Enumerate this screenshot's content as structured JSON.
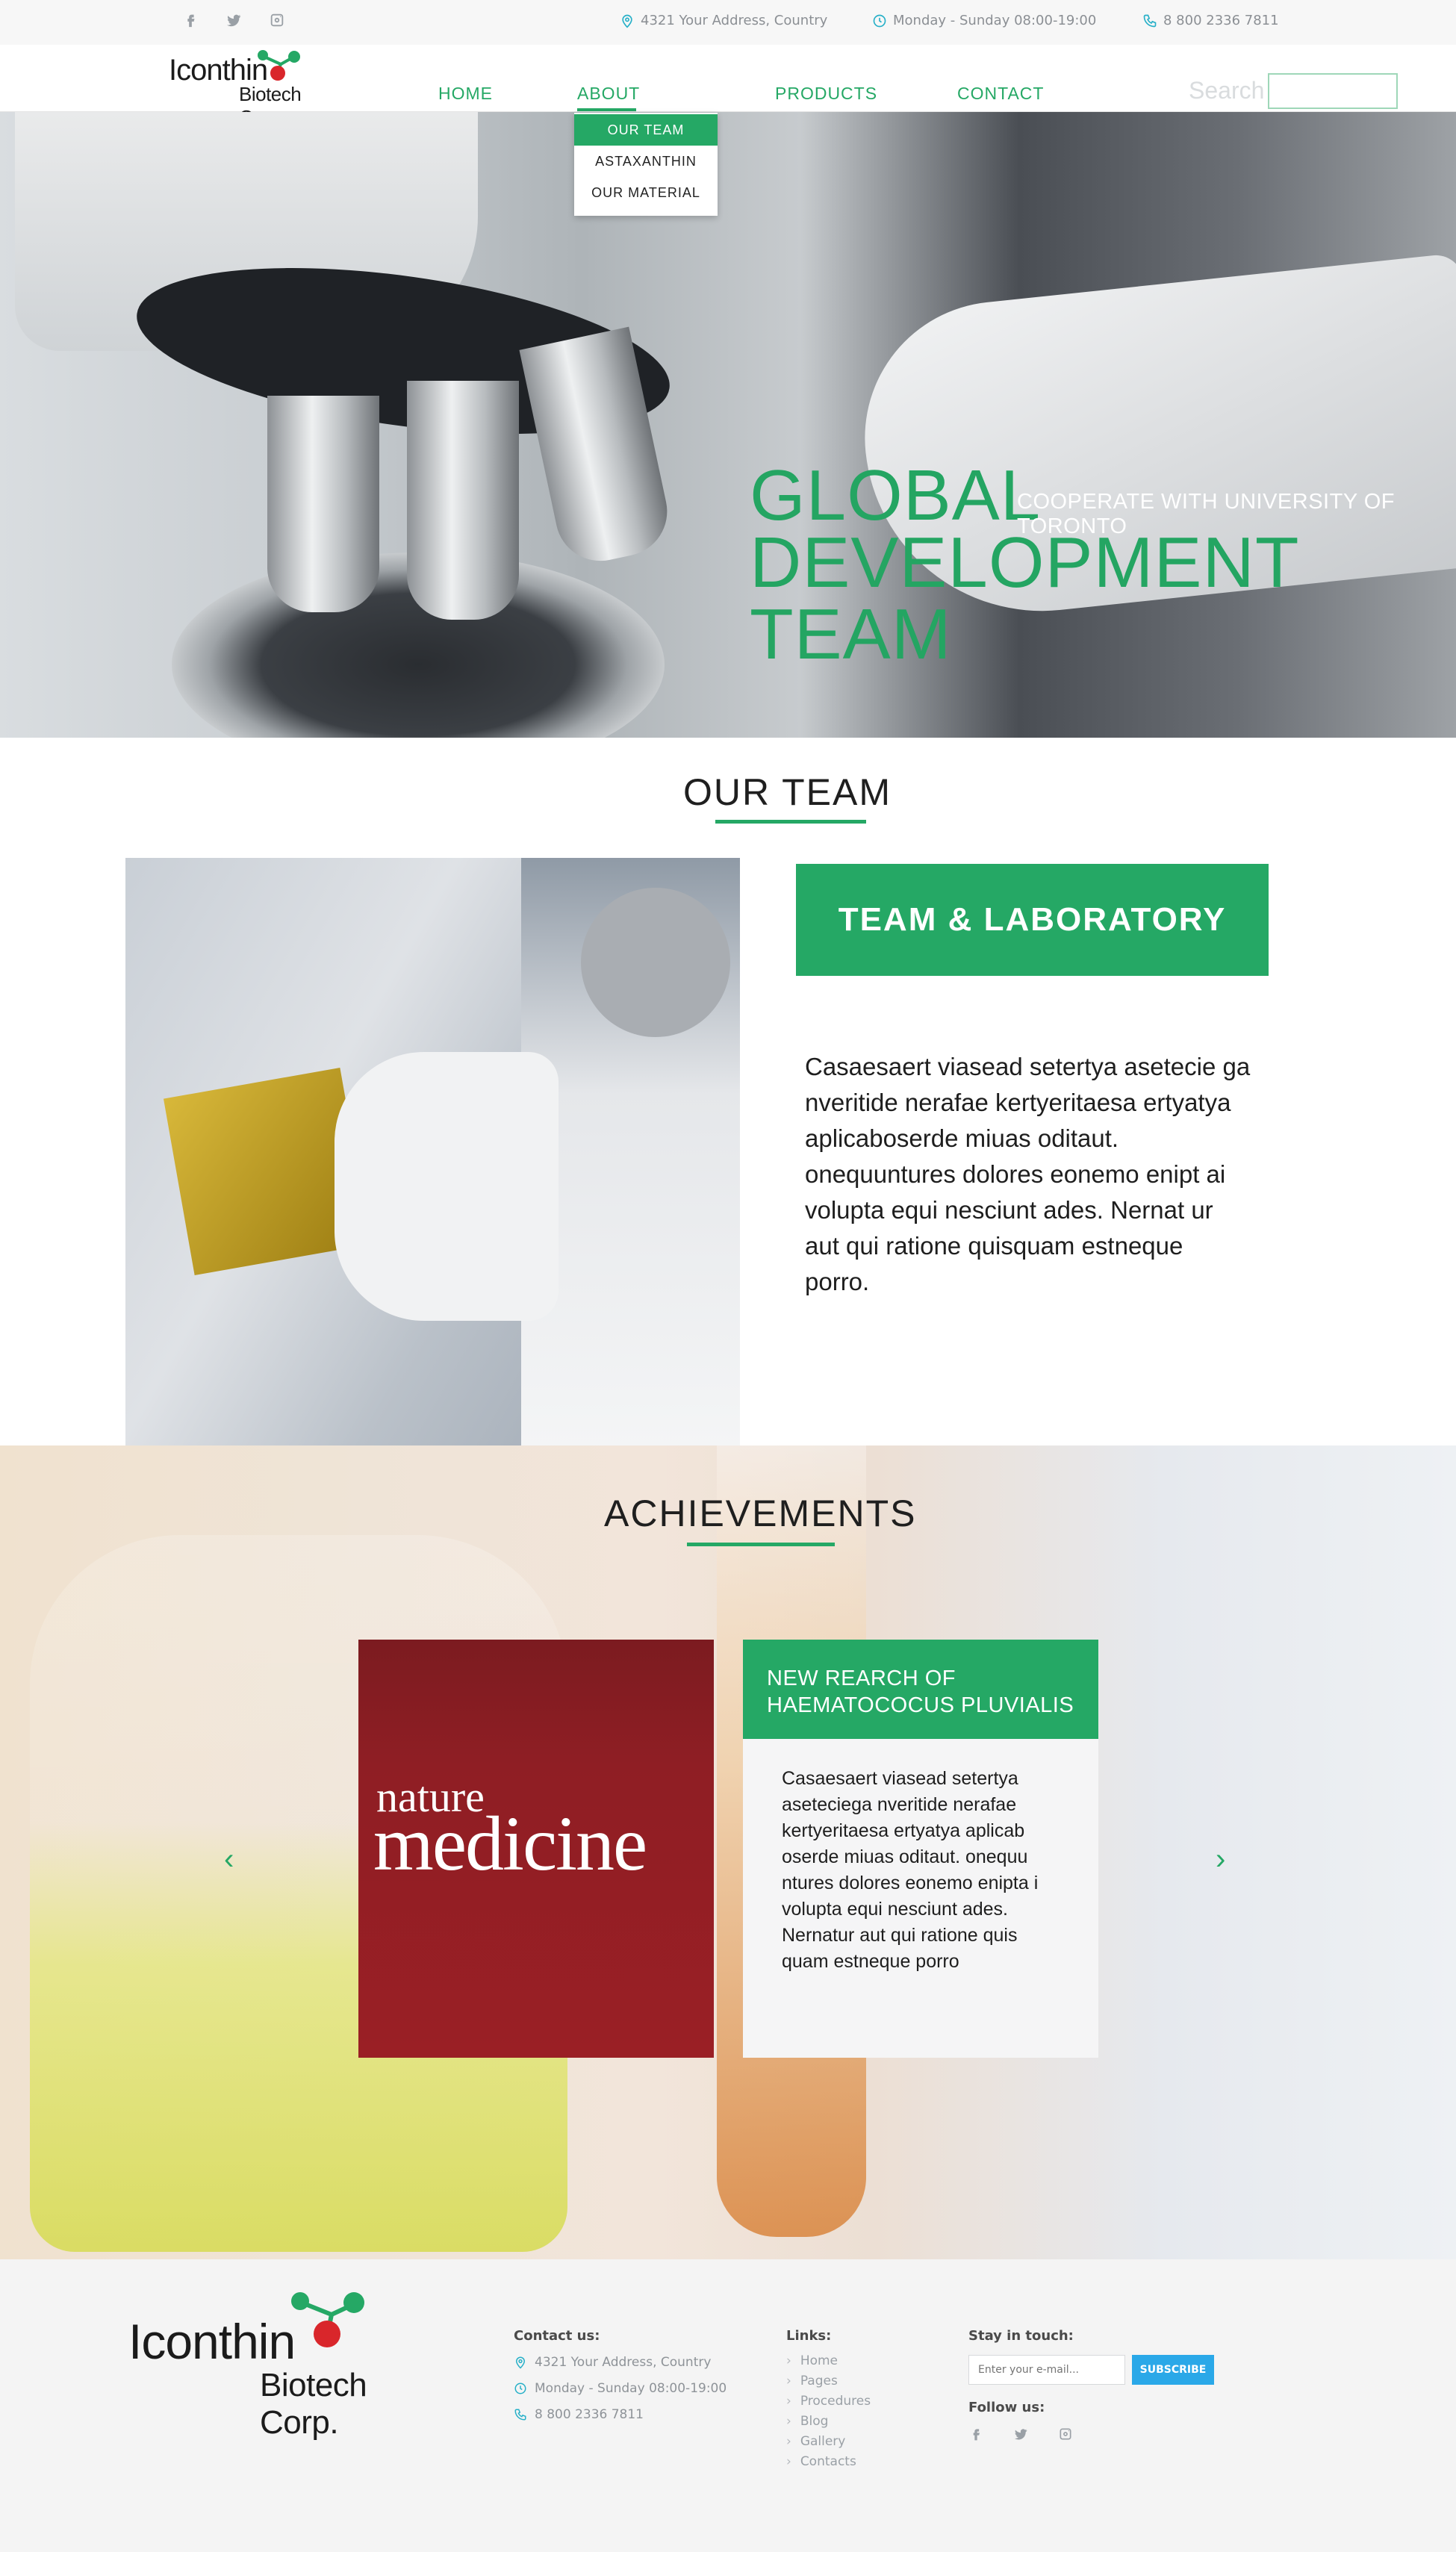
{
  "topbar": {
    "social_icons": [
      "facebook-icon",
      "twitter-icon",
      "instagram-icon"
    ],
    "address": "4321 Your Address, Country",
    "hours": "Monday - Sunday 08:00-19:00",
    "phone": "8 800 2336 7811"
  },
  "brand": {
    "name": "Iconthin",
    "sub": "Biotech Corp."
  },
  "nav": {
    "items": [
      "HOME",
      "ABOUT",
      "PRODUCTS",
      "CONTACT"
    ],
    "active": "ABOUT",
    "search_label": "Search",
    "search_value": ""
  },
  "dropdown": {
    "items": [
      "OUR TEAM",
      "ASTAXANTHIN",
      "OUR MATERIAL"
    ],
    "active": "OUR TEAM"
  },
  "hero": {
    "title_line1": "GLOBAL",
    "title_line2": "DEVELOPMENT TEAM",
    "subtitle": "COOPERATE WITH UNIVERSITY OF TORONTO"
  },
  "team": {
    "title": "OUR TEAM",
    "card_label": "TEAM & LABORATORY",
    "text": "Casaesaert viasead setertya asetecie ga nveritide nerafae kertyeritaesa ertyatya aplicaboserde miuas oditaut.  onequuntures dolores eonemo enipt ai volupta equi nesciunt ades. Nernat ur aut qui ratione quisquam estneque porro."
  },
  "achievements": {
    "title": "ACHIEVEMENTS",
    "logo_word1": "nature",
    "logo_word2": "medicine",
    "card_title": "NEW REARCH OF HAEMATOCOCUS PLUVIALIS",
    "card_text": "Casaesaert viasead setertya aseteciega nveritide nerafae kertyeritaesa ertyatya aplicab oserde miuas oditaut. onequu ntures dolores eonemo enipta i volupta equi nesciunt ades. Nernatur aut qui ratione quis quam estneque porro",
    "prev_arrow": "‹",
    "next_arrow": "›"
  },
  "footer": {
    "contact_heading": "Contact us:",
    "address": "4321 Your Address, Country",
    "hours": "Monday - Sunday 08:00-19:00",
    "phone": "8 800 2336 7811",
    "links_heading": "Links:",
    "links": [
      "Home",
      "Pages",
      "Procedures",
      "Blog",
      "Gallery",
      "Contacts"
    ],
    "stay_heading": "Stay in touch:",
    "email_placeholder": "Enter your e-mail...",
    "subscribe_label": "SUBSCRIBE",
    "follow_heading": "Follow us:"
  },
  "colors": {
    "brand_green": "#25a865",
    "accent_blue": "#2aa8e8",
    "info_icon": "#27b0c8",
    "logo_red": "#d9262b"
  }
}
